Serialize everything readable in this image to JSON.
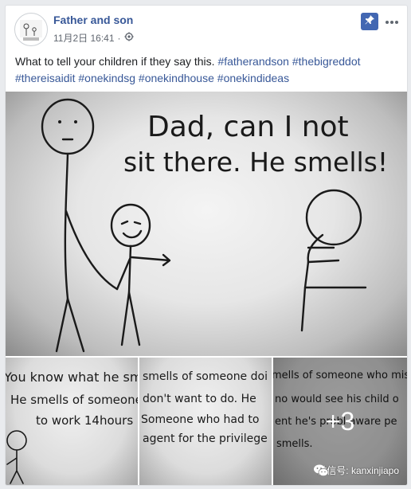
{
  "post": {
    "page_name": "Father and son",
    "timestamp": "11月2日 16:41",
    "dot": "·",
    "caption_text": "What to tell your children if they say this. ",
    "hashtags": [
      "#fatherandson",
      "#thebigreddot",
      "#thereisaidit",
      "#onekindsg",
      "#onekindhouse",
      "#onekindideas"
    ]
  },
  "main_photo": {
    "line1": "Dad, can I not",
    "line2": "sit there. He smells!"
  },
  "thumbs": [
    {
      "lines": [
        "You know what he sme",
        "He smells of someone",
        "to work 14hours"
      ]
    },
    {
      "lines": [
        "smells of someone doi",
        "don't want to do. He",
        "Someone who had to",
        "agent for the privilege"
      ]
    },
    {
      "lines": [
        "mells of someone who misse",
        "no would see his child o",
        "ent he's probl  aware pe",
        "smells."
      ]
    }
  ],
  "more_count": "+3",
  "watermark": "微信号: kanxinjiapo",
  "colors": {
    "link": "#385898",
    "pin": "#4267b2"
  },
  "icons": {
    "pin": "pin-icon",
    "more": "more-icon",
    "privacy": "globe-icon",
    "wechat": "wechat-icon"
  }
}
